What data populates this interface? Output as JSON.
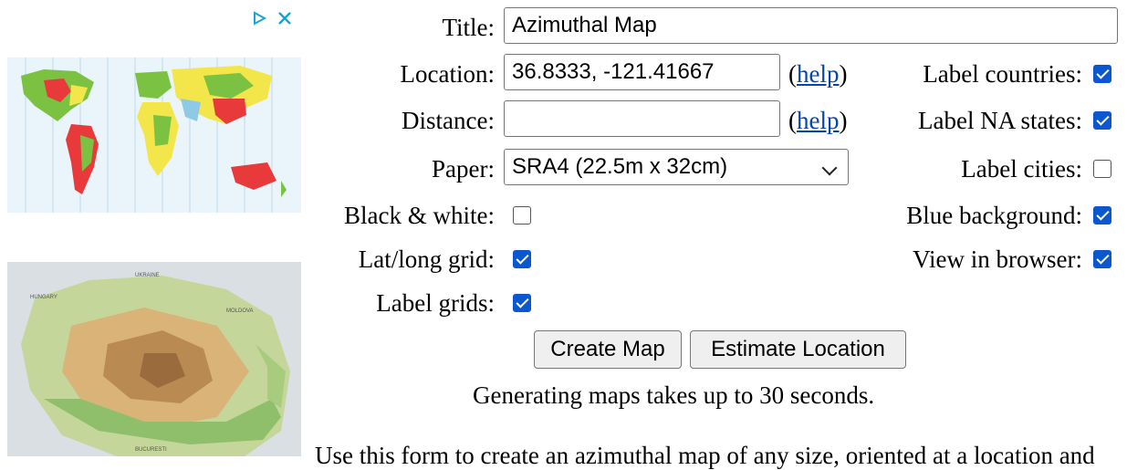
{
  "ad": {
    "play_icon": "adchoices-triangle-icon",
    "close_icon": "close-x-icon"
  },
  "form": {
    "title_label": "Title:",
    "title_value": "Azimuthal Map",
    "location_label": "Location:",
    "location_value": "36.8333, -121.41667",
    "distance_label": "Distance:",
    "distance_value": "",
    "help_text": "help",
    "paper_label": "Paper:",
    "paper_value": "SRA4 (22.5m x 32cm)",
    "bw_label": "Black & white:",
    "latlong_label": "Lat/long grid:",
    "labelgrids_label": "Label grids:",
    "label_countries_label": "Label countries:",
    "label_na_states_label": "Label NA states:",
    "label_cities_label": "Label cities:",
    "blue_background_label": "Blue background:",
    "view_in_browser_label": "View in browser:",
    "checkboxes": {
      "black_white": false,
      "latlong_grid": true,
      "label_grids": true,
      "label_countries": true,
      "label_na_states": true,
      "label_cities": false,
      "blue_background": true,
      "view_in_browser": true
    }
  },
  "buttons": {
    "create_map": "Create Map",
    "estimate_location": "Estimate Location"
  },
  "notice": "Generating maps takes up to 30 seconds.",
  "bottom_text": "Use this form to create an azimuthal map of any size, oriented at a location and",
  "colors": {
    "checkbox": "#0b57d0",
    "link": "#0645ad"
  }
}
